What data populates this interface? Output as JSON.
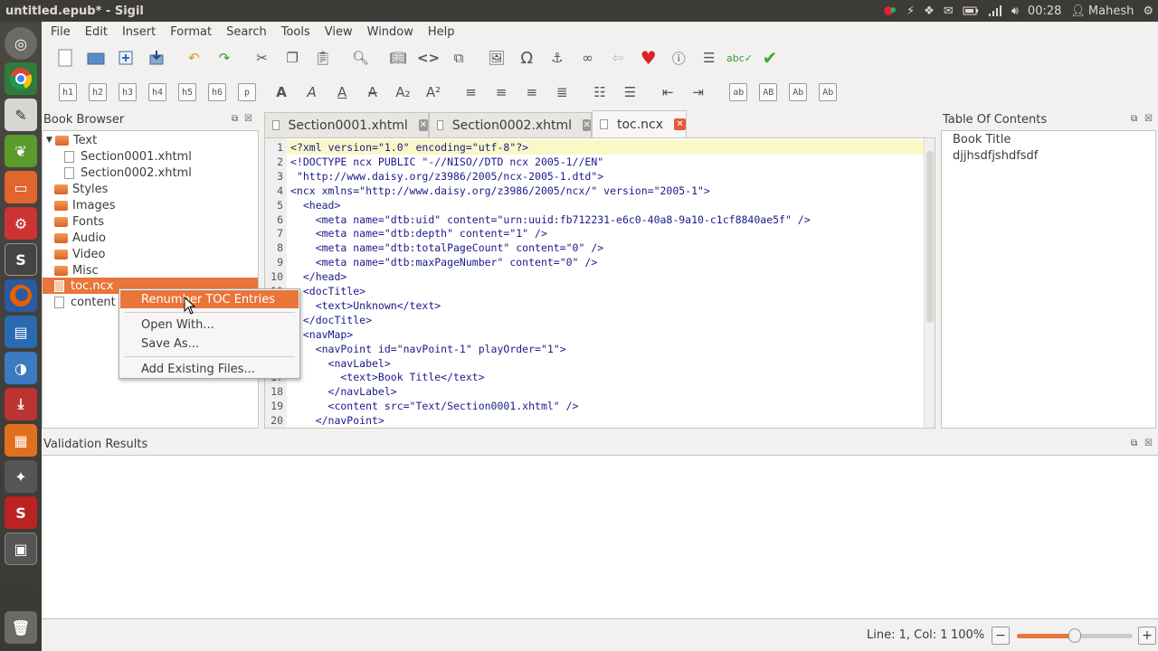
{
  "window": {
    "title": "untitled.epub* - Sigil"
  },
  "tray": {
    "clock": "00:28",
    "user": "Mahesh"
  },
  "menubar": [
    "File",
    "Edit",
    "Insert",
    "Format",
    "Search",
    "Tools",
    "View",
    "Window",
    "Help"
  ],
  "toolbar2": {
    "headings": [
      "h1",
      "h2",
      "h3",
      "h4",
      "h5",
      "h6",
      "p"
    ],
    "case_buttons": [
      "ab",
      "AB",
      "Ab",
      "Ab"
    ]
  },
  "book_browser": {
    "title": "Book Browser",
    "items": [
      {
        "label": "Text",
        "kind": "folder",
        "expanded": true
      },
      {
        "label": "Section0001.xhtml",
        "kind": "file"
      },
      {
        "label": "Section0002.xhtml",
        "kind": "file"
      },
      {
        "label": "Styles",
        "kind": "folder"
      },
      {
        "label": "Images",
        "kind": "folder"
      },
      {
        "label": "Fonts",
        "kind": "folder"
      },
      {
        "label": "Audio",
        "kind": "folder"
      },
      {
        "label": "Video",
        "kind": "folder"
      },
      {
        "label": "Misc",
        "kind": "folder"
      },
      {
        "label": "toc.ncx",
        "kind": "file",
        "selected": true
      },
      {
        "label": "content",
        "kind": "file"
      }
    ]
  },
  "context_menu": {
    "items": [
      "Renumber TOC Entries",
      "Open With...",
      "Save As...",
      "Add Existing Files..."
    ]
  },
  "tabs": [
    {
      "label": "Section0001.xhtml",
      "active": false
    },
    {
      "label": "Section0002.xhtml",
      "active": false
    },
    {
      "label": "toc.ncx",
      "active": true
    }
  ],
  "editor": {
    "line_numbers": [
      "1",
      "2",
      "3",
      "4",
      "5",
      "6",
      "7",
      "8",
      "9",
      "10",
      "11",
      "12",
      "13",
      "14",
      "15",
      "16",
      "17",
      "18",
      "19",
      "20"
    ],
    "lines": [
      "<?xml version=\"1.0\" encoding=\"utf-8\"?>",
      "<!DOCTYPE ncx PUBLIC \"-//NISO//DTD ncx 2005-1//EN\"",
      " \"http://www.daisy.org/z3986/2005/ncx-2005-1.dtd\">",
      "<ncx xmlns=\"http://www.daisy.org/z3986/2005/ncx/\" version=\"2005-1\">",
      "  <head>",
      "    <meta name=\"dtb:uid\" content=\"urn:uuid:fb712231-e6c0-40a8-9a10-c1cf8840ae5f\" />",
      "    <meta name=\"dtb:depth\" content=\"1\" />",
      "    <meta name=\"dtb:totalPageCount\" content=\"0\" />",
      "    <meta name=\"dtb:maxPageNumber\" content=\"0\" />",
      "  </head>",
      "  <docTitle>",
      "    <text>Unknown</text>",
      "  </docTitle>",
      "  <navMap>",
      "    <navPoint id=\"navPoint-1\" playOrder=\"1\">",
      "      <navLabel>",
      "        <text>Book Title</text>",
      "      </navLabel>",
      "      <content src=\"Text/Section0001.xhtml\" />",
      "    </navPoint>"
    ]
  },
  "toc": {
    "title": "Table Of Contents",
    "entries": [
      "Book Title",
      "djjhsdfjshdfsdf"
    ]
  },
  "validation": {
    "title": "Validation Results"
  },
  "status": {
    "position": "Line: 1, Col: 1",
    "zoom": "100%",
    "zoom_level": 0.5
  }
}
